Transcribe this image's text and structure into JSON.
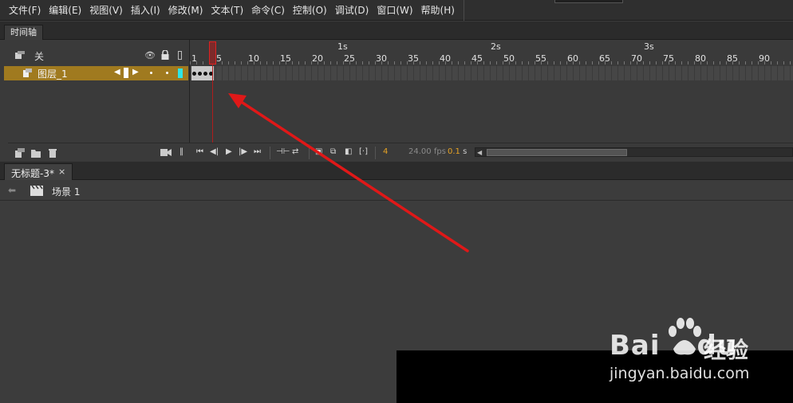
{
  "menubar": {
    "items": [
      "文件(F)",
      "编辑(E)",
      "视图(V)",
      "插入(I)",
      "修改(M)",
      "文本(T)",
      "命令(C)",
      "控制(O)",
      "调试(D)",
      "窗口(W)",
      "帮助(H)"
    ]
  },
  "timeline": {
    "tab_label": "时间轴",
    "header_label": "关",
    "layer": {
      "name": "图层_1",
      "color": "#2ee6e6"
    },
    "seconds": [
      "1s",
      "2s",
      "3s"
    ],
    "frame_numbers": [
      "1",
      "5",
      "10",
      "15",
      "20",
      "25",
      "30",
      "35",
      "40",
      "45",
      "50",
      "55",
      "60",
      "65",
      "70",
      "75",
      "80",
      "85",
      "90"
    ],
    "current_frame": "4",
    "fps": "24.00",
    "fps_unit": "fps",
    "time": "0.1",
    "time_unit": "s",
    "keyframe_count": 4,
    "colors": {
      "layer_highlight": "#a07a1f",
      "playhead": "#d22222",
      "frame_value": "#e8a324"
    }
  },
  "document": {
    "tab_label": "无标题-3*",
    "close_glyph": "×",
    "scene_label": "场景 1"
  },
  "annotation": {
    "arrow_color": "#e01818"
  },
  "watermark": {
    "brand": "Bai",
    "brand_suffix": "du",
    "cn": "经验",
    "url": "jingyan.baidu.com"
  }
}
